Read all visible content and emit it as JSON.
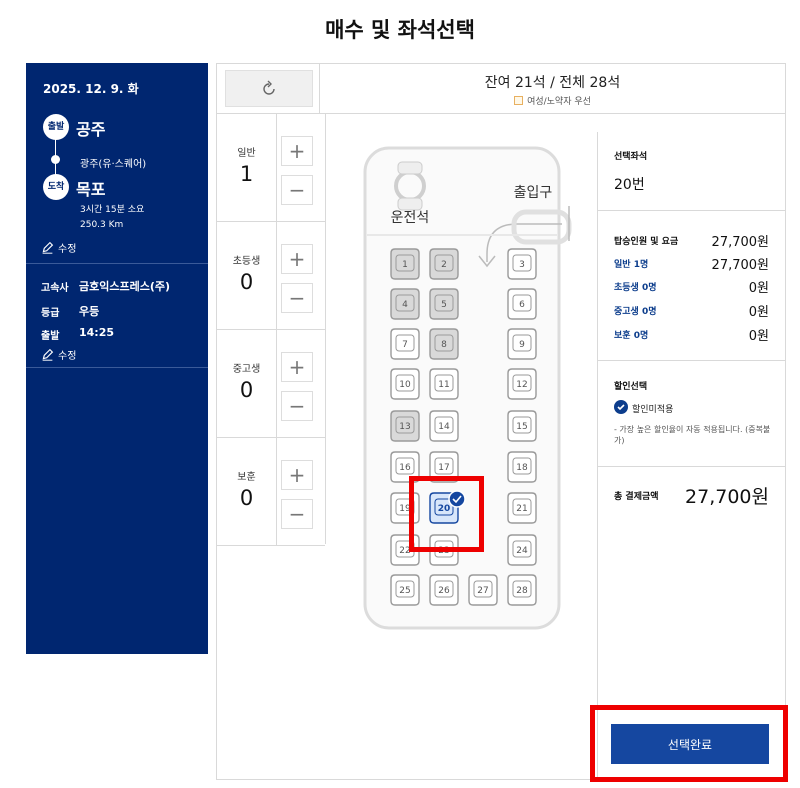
{
  "page_title": "매수 및 좌석선택",
  "sidebar": {
    "date": "2025. 12. 9. 화",
    "depart_badge": "출발",
    "depart_city": "공주",
    "via": "광주(유·스퀘어)",
    "arrive_badge": "도착",
    "arrive_city": "목포",
    "duration": "3시간 15분 소요",
    "distance": "250.3 Km",
    "edit_label": "수정",
    "company_label": "고속사",
    "company_value": "금호익스프레스(주)",
    "grade_label": "등급",
    "grade_value": "우등",
    "depart_time_label": "출발",
    "depart_time_value": "14:25",
    "edit_label2": "수정"
  },
  "header": {
    "seat_summary": "잔여 21석 / 전체 28석",
    "legend_label": "여성/노약자 우선"
  },
  "counters": [
    {
      "label": "일반",
      "value": "1"
    },
    {
      "label": "초등생",
      "value": "0"
    },
    {
      "label": "중고생",
      "value": "0"
    },
    {
      "label": "보훈",
      "value": "0"
    }
  ],
  "counter_icons": {
    "plus": "plus-icon",
    "minus": "minus-icon"
  },
  "bus": {
    "driver_label": "운전석",
    "entrance_label": "출입구",
    "seats": [
      {
        "no": "1",
        "status": "taken"
      },
      {
        "no": "2",
        "status": "taken"
      },
      {
        "no": "3",
        "status": "free"
      },
      {
        "no": "4",
        "status": "taken"
      },
      {
        "no": "5",
        "status": "taken"
      },
      {
        "no": "6",
        "status": "free"
      },
      {
        "no": "7",
        "status": "free"
      },
      {
        "no": "8",
        "status": "taken"
      },
      {
        "no": "9",
        "status": "free"
      },
      {
        "no": "10",
        "status": "free"
      },
      {
        "no": "11",
        "status": "free"
      },
      {
        "no": "12",
        "status": "free"
      },
      {
        "no": "13",
        "status": "taken"
      },
      {
        "no": "14",
        "status": "free"
      },
      {
        "no": "15",
        "status": "free"
      },
      {
        "no": "16",
        "status": "free"
      },
      {
        "no": "17",
        "status": "free"
      },
      {
        "no": "18",
        "status": "free"
      },
      {
        "no": "19",
        "status": "free"
      },
      {
        "no": "20",
        "status": "selected"
      },
      {
        "no": "21",
        "status": "free"
      },
      {
        "no": "22",
        "status": "free"
      },
      {
        "no": "23",
        "status": "free"
      },
      {
        "no": "24",
        "status": "free"
      },
      {
        "no": "25",
        "status": "free"
      },
      {
        "no": "26",
        "status": "free"
      },
      {
        "no": "27",
        "status": "free"
      },
      {
        "no": "28",
        "status": "free"
      }
    ]
  },
  "info": {
    "selected_seat_title": "선택좌석",
    "selected_seat_value": "20번",
    "fare_title": "탑승인원 및 요금",
    "fare_total": "27,700원",
    "rows": [
      {
        "label": "일반 1명",
        "value": "27,700원"
      },
      {
        "label": "초등생 0명",
        "value": "0원"
      },
      {
        "label": "중고생 0명",
        "value": "0원"
      },
      {
        "label": "보훈 0명",
        "value": "0원"
      }
    ],
    "discount_title": "할인선택",
    "discount_option": "할인미적용",
    "discount_note": "- 가장 높은 할인율이 자동 적용됩니다. (중복불가)",
    "total_label": "총 결제금액",
    "total_value": "27,700원"
  },
  "confirm_button": "선택완료",
  "colors": {
    "navy": "#002670",
    "button_blue": "#1547a0",
    "highlight_red": "#ee0000"
  }
}
